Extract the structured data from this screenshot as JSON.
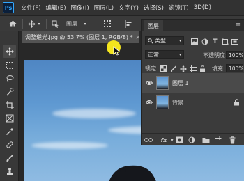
{
  "app": {
    "logo": "Ps"
  },
  "menu": [
    "文件(F)",
    "编辑(E)",
    "图像(I)",
    "图层(L)",
    "文字(Y)",
    "选择(S)",
    "滤镜(T)",
    "3D(D)"
  ],
  "options": {
    "auto_select_target": "图层"
  },
  "document": {
    "tab_title": "调整逆光.jpg @ 53.7% (图层 1, RGB/8) *",
    "close_symbol": "×"
  },
  "layers_panel": {
    "tab_label": "图层",
    "menu_symbol": "≡",
    "filter_kind": "类型",
    "blend_mode": "正常",
    "opacity_label": "不透明度:",
    "opacity_value": "100%",
    "lock_label": "锁定:",
    "fill_label": "填充:",
    "fill_value": "100%",
    "layers": [
      {
        "name": "图层 1",
        "visible": true,
        "selected": true,
        "locked": false
      },
      {
        "name": "背景",
        "visible": true,
        "selected": false,
        "locked": true
      }
    ],
    "footer_fx": "fx"
  },
  "colors": {
    "accent": "#31a8ff",
    "cursor_highlight": "#f4e51d"
  }
}
